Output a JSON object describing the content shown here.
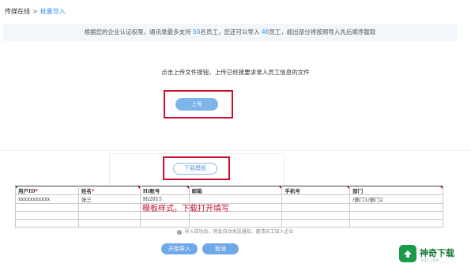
{
  "breadcrumb": {
    "root": "传媒在线",
    "separator": ">",
    "current": "批量导入"
  },
  "notice": {
    "before": "根据您的企业认证权限，通讯录最多支持 ",
    "max": "50",
    "middle": "名员工，您还可以导入 ",
    "remaining": "48",
    "after": "员工，超出部分将按照导入先后顺序截取"
  },
  "hint": "点击上传文件按钮，上传已经按要求录入员工信息的文件",
  "buttons": {
    "upload": "上传",
    "download_template": "下载模板",
    "start_import": "开始导入",
    "cancel": "取消"
  },
  "template": {
    "headers": [
      "用户ID",
      "姓名",
      "Hi账号",
      "邮箱",
      "手机号",
      "部门"
    ],
    "required": [
      true,
      true,
      false,
      false,
      false,
      false
    ],
    "rows": [
      [
        "xxxxxxxxxxx",
        "张三",
        "Hi2015",
        "",
        "",
        "/部门1/部门2"
      ],
      [
        "",
        "",
        "",
        "",
        "",
        ""
      ],
      [
        "",
        "",
        "",
        "",
        "",
        ""
      ],
      [
        "",
        "",
        "",
        "",
        "",
        ""
      ]
    ],
    "req_mark": "*"
  },
  "caption": "模板样式，下载打开填写",
  "success_note": "导入成功后，将会自动发送通知，邀请员工加入企业",
  "watermark": {
    "text": "神奇下载",
    "sub": "SQ2.COM"
  },
  "colors": {
    "accent": "#3a8ee6",
    "button": "#6fa8e8",
    "highlight_box": "#c8102e",
    "watermark_green": "#1a9b47"
  }
}
